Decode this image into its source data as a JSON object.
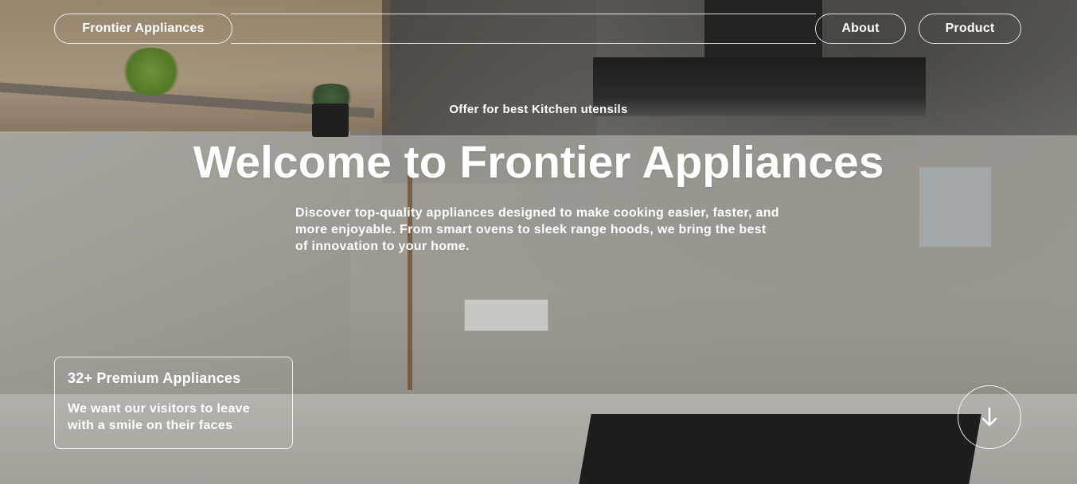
{
  "nav": {
    "brand": "Frontier Appliances",
    "links": [
      {
        "label": "About"
      },
      {
        "label": "Product"
      }
    ]
  },
  "hero": {
    "eyebrow": "Offer for best Kitchen utensils",
    "headline": "Welcome to Frontier Appliances",
    "description": "Discover top-quality appliances designed to make cooking easier, faster, and more enjoyable. From smart ovens to sleek range hoods, we bring the best of innovation to your home."
  },
  "stats_card": {
    "title": "32+ Premium Appliances",
    "text": "We want our visitors to leave with a smile on their faces"
  },
  "scroll_button": {
    "icon": "arrow-down-icon"
  },
  "colors": {
    "text": "#ffffff",
    "border": "#ffffff"
  }
}
